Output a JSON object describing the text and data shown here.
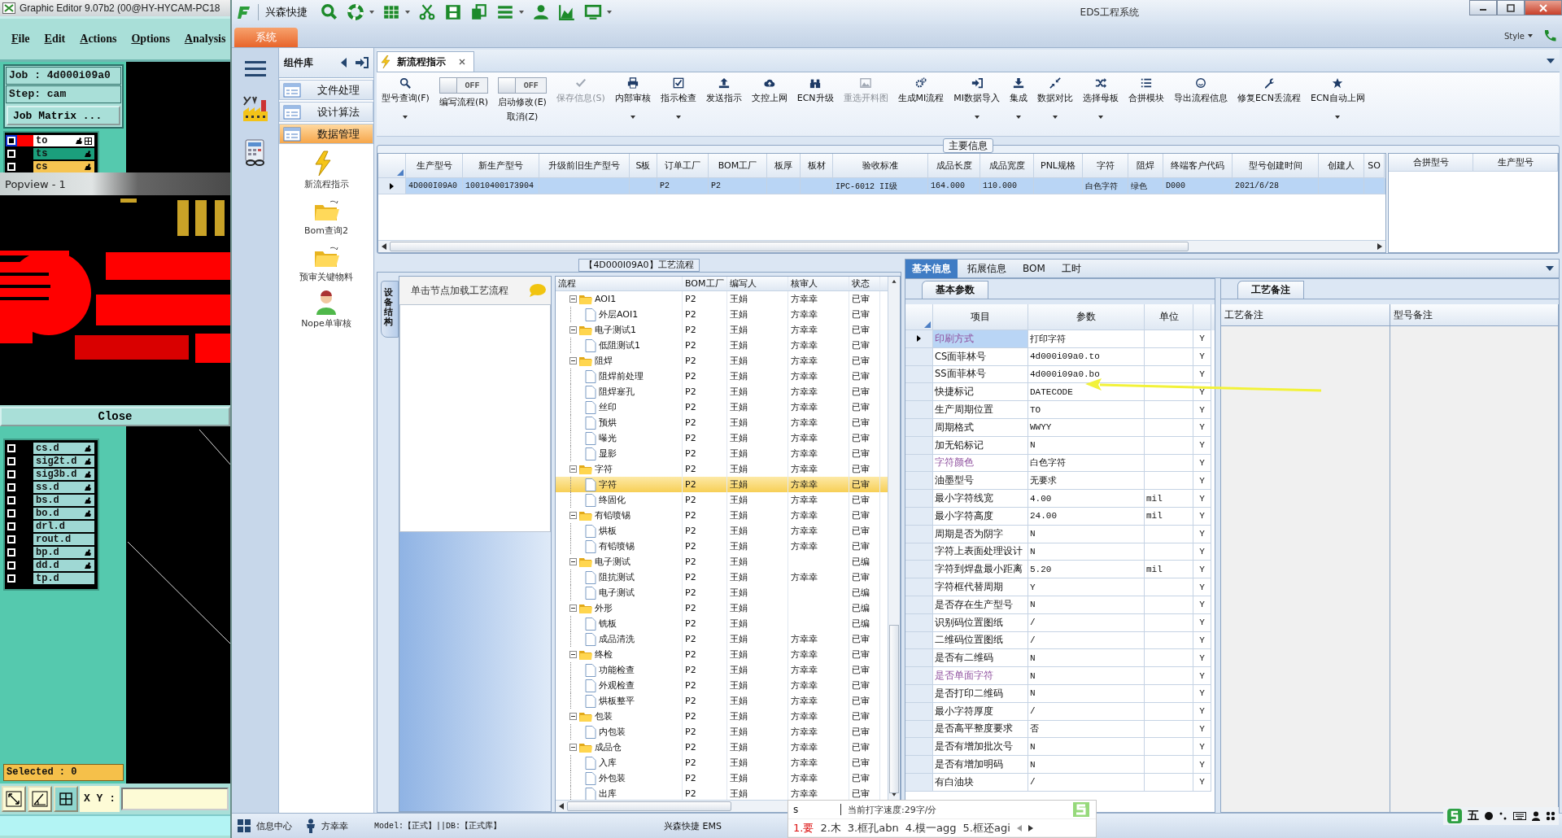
{
  "graphic_editor": {
    "title": "Graphic Editor 9.07b2 (00@HY-HYCAM-PC18",
    "menu": [
      "File",
      "Edit",
      "Actions",
      "Options",
      "Analysis"
    ],
    "job": "Job : 4d000i09a0",
    "step": "Step: cam",
    "job_matrix_button": "Job Matrix ...",
    "top_layers": [
      {
        "name": "to",
        "color": "#ffffff",
        "selected": true,
        "checked": false,
        "flagged": true
      },
      {
        "name": "ts",
        "color": "#1b9f7c",
        "selected": false,
        "checked": false,
        "flagged": true
      },
      {
        "name": "cs",
        "color": "#f6c451",
        "selected": false,
        "checked": false,
        "flagged": true
      }
    ],
    "popview": {
      "title": "Popview - 1",
      "close_button": "Close"
    },
    "layers": [
      {
        "name": "cs.d",
        "checked": false,
        "flagged": true
      },
      {
        "name": "sig2t.d",
        "checked": false,
        "flagged": true
      },
      {
        "name": "sig3b.d",
        "checked": false,
        "flagged": true
      },
      {
        "name": "ss.d",
        "checked": false,
        "flagged": true
      },
      {
        "name": "bs.d",
        "checked": false,
        "flagged": true
      },
      {
        "name": "bo.d",
        "checked": false,
        "flagged": true
      },
      {
        "name": "drl.d",
        "checked": false,
        "flagged": false
      },
      {
        "name": "rout.d",
        "checked": false,
        "flagged": false
      },
      {
        "name": "bp.d",
        "checked": false,
        "flagged": true
      },
      {
        "name": "dd.d",
        "checked": false,
        "flagged": true
      },
      {
        "name": "tp.d",
        "checked": false,
        "flagged": false
      }
    ],
    "selected_count": "Selected : 0",
    "xy_label": "X Y :"
  },
  "eds": {
    "app_name": "兴森快捷",
    "title": "EDS工程系统",
    "menu": [
      {
        "label": "系统",
        "selected": true
      }
    ],
    "style_label": "Style",
    "sidebar": {
      "title": "组件库",
      "categories": [
        {
          "label": "文件处理",
          "selected": false
        },
        {
          "label": "设计算法",
          "selected": false
        },
        {
          "label": "数据管理",
          "selected": true
        }
      ],
      "modules": [
        {
          "label": "新流程指示",
          "kind": "lightning"
        },
        {
          "label": "Bom查询2",
          "kind": "folder"
        },
        {
          "label": "预审关键物料",
          "kind": "folder"
        },
        {
          "label": "Nope单审核",
          "kind": "user"
        }
      ]
    },
    "doc_tab": {
      "label": "新流程指示"
    },
    "toolbar": [
      {
        "kind": "button",
        "label": "型号查询(F)",
        "dropdown": true,
        "disabled": false
      },
      {
        "kind": "toggle",
        "label": "编写流程(R)",
        "switch_text": "OFF",
        "on": false
      },
      {
        "kind": "toggle",
        "label": "启动修改(E)",
        "second_line": "取消(Z)",
        "switch_text": "OFF",
        "on": false
      },
      {
        "kind": "button",
        "label": "保存信息(S)",
        "dropdown": false,
        "disabled": true
      },
      {
        "kind": "button",
        "label": "内部审核",
        "dropdown": true,
        "disabled": false
      },
      {
        "kind": "button",
        "label": "指示检查",
        "dropdown": true,
        "disabled": false
      },
      {
        "kind": "button",
        "label": "发送指示",
        "dropdown": false,
        "disabled": false
      },
      {
        "kind": "button",
        "label": "文控上网",
        "dropdown": false,
        "disabled": false
      },
      {
        "kind": "button",
        "label": "ECN升级",
        "dropdown": false,
        "disabled": false
      },
      {
        "kind": "button",
        "label": "重选开料图",
        "dropdown": false,
        "disabled": true
      },
      {
        "kind": "button",
        "label": "生成MI流程",
        "dropdown": false,
        "disabled": false
      },
      {
        "kind": "button",
        "label": "MI数据导入",
        "dropdown": true,
        "disabled": false
      },
      {
        "kind": "button",
        "label": "集成",
        "dropdown": true,
        "disabled": false
      },
      {
        "kind": "button",
        "label": "数据对比",
        "dropdown": true,
        "disabled": false
      },
      {
        "kind": "button",
        "label": "选择母板",
        "dropdown": true,
        "disabled": false
      },
      {
        "kind": "button",
        "label": "合拼模块",
        "dropdown": false,
        "disabled": false
      },
      {
        "kind": "button",
        "label": "导出流程信息",
        "dropdown": false,
        "disabled": false
      },
      {
        "kind": "button",
        "label": "修复ECN丢流程",
        "dropdown": false,
        "disabled": false
      },
      {
        "kind": "button",
        "label": "ECN自动上网",
        "dropdown": true,
        "disabled": false
      }
    ],
    "main_info": {
      "title": "主要信息",
      "columns": [
        "生产型号",
        "新生产型号",
        "升级前旧生产型号",
        "S板",
        "订单工厂",
        "BOM工厂",
        "板厚",
        "板材",
        "验收标准",
        "成品长度",
        "成品宽度",
        "PNL规格",
        "字符",
        "阻焊",
        "终端客户代码",
        "型号创建时间",
        "创建人",
        "SO"
      ],
      "rows": [
        {
          "selected": true,
          "cells": [
            "4D000I09A0",
            "10010400173904",
            null,
            null,
            "P2",
            "P2",
            null,
            null,
            "IPC-6012 II级",
            "164.000",
            "110.000",
            null,
            "白色字符",
            "绿色",
            "D000",
            "2021/6/28",
            null,
            null
          ]
        }
      ],
      "side_columns": [
        "合拼型号",
        "生产型号"
      ]
    },
    "process": {
      "title": "【4D000I09A0】工艺流程",
      "side_tab": "设备结构",
      "hint": "单击节点加载工艺流程",
      "columns": [
        "流程",
        "BOM工厂",
        "编写人",
        "核审人",
        "状态"
      ],
      "tree": [
        {
          "name": "AOI1",
          "factory": "P2",
          "writer": "王娟",
          "reviewer": "方幸幸",
          "status": "已审",
          "expanded": true,
          "selected": false,
          "children": [
            {
              "name": "外层AOI1",
              "factory": "P2",
              "writer": "王娟",
              "reviewer": "方幸幸",
              "status": "已审",
              "selected": false
            }
          ]
        },
        {
          "name": "电子测试1",
          "factory": "P2",
          "writer": "王娟",
          "reviewer": "方幸幸",
          "status": "已审",
          "expanded": true,
          "selected": false,
          "children": [
            {
              "name": "低阻测试1",
              "factory": "P2",
              "writer": "王娟",
              "reviewer": "方幸幸",
              "status": "已审",
              "selected": false
            }
          ]
        },
        {
          "name": "阻焊",
          "factory": "P2",
          "writer": "王娟",
          "reviewer": "方幸幸",
          "status": "已审",
          "expanded": true,
          "selected": false,
          "children": [
            {
              "name": "阻焊前处理",
              "factory": "P2",
              "writer": "王娟",
              "reviewer": "方幸幸",
              "status": "已审",
              "selected": false
            },
            {
              "name": "阻焊塞孔",
              "factory": "P2",
              "writer": "王娟",
              "reviewer": "方幸幸",
              "status": "已审",
              "selected": false
            },
            {
              "name": "丝印",
              "factory": "P2",
              "writer": "王娟",
              "reviewer": "方幸幸",
              "status": "已审",
              "selected": false
            },
            {
              "name": "预烘",
              "factory": "P2",
              "writer": "王娟",
              "reviewer": "方幸幸",
              "status": "已审",
              "selected": false
            },
            {
              "name": "曝光",
              "factory": "P2",
              "writer": "王娟",
              "reviewer": "方幸幸",
              "status": "已审",
              "selected": false
            },
            {
              "name": "显影",
              "factory": "P2",
              "writer": "王娟",
              "reviewer": "方幸幸",
              "status": "已审",
              "selected": false
            }
          ]
        },
        {
          "name": "字符",
          "factory": "P2",
          "writer": "王娟",
          "reviewer": "方幸幸",
          "status": "已审",
          "expanded": true,
          "selected": false,
          "children": [
            {
              "name": "字符",
              "factory": "P2",
              "writer": "王娟",
              "reviewer": "方幸幸",
              "status": "已审",
              "selected": true
            },
            {
              "name": "终固化",
              "factory": "P2",
              "writer": "王娟",
              "reviewer": "方幸幸",
              "status": "已审",
              "selected": false
            }
          ]
        },
        {
          "name": "有铅喷锡",
          "factory": "P2",
          "writer": "王娟",
          "reviewer": "方幸幸",
          "status": "已审",
          "expanded": true,
          "selected": false,
          "children": [
            {
              "name": "烘板",
              "factory": "P2",
              "writer": "王娟",
              "reviewer": "方幸幸",
              "status": "已审",
              "selected": false
            },
            {
              "name": "有铅喷锡",
              "factory": "P2",
              "writer": "王娟",
              "reviewer": "方幸幸",
              "status": "已审",
              "selected": false
            }
          ]
        },
        {
          "name": "电子测试",
          "factory": "P2",
          "writer": "王娟",
          "status": "已编",
          "expanded": true,
          "selected": false,
          "children": [
            {
              "name": "阻抗测试",
              "factory": "P2",
              "writer": "王娟",
              "reviewer": "方幸幸",
              "status": "已审",
              "selected": false
            },
            {
              "name": "电子测试",
              "factory": "P2",
              "writer": "王娟",
              "status": "已编",
              "selected": false
            }
          ]
        },
        {
          "name": "外形",
          "factory": "P2",
          "writer": "王娟",
          "status": "已编",
          "expanded": true,
          "selected": false,
          "children": [
            {
              "name": "铣板",
              "factory": "P2",
              "writer": "王娟",
              "status": "已编",
              "selected": false
            },
            {
              "name": "成品清洗",
              "factory": "P2",
              "writer": "王娟",
              "reviewer": "方幸幸",
              "status": "已审",
              "selected": false
            }
          ]
        },
        {
          "name": "终检",
          "factory": "P2",
          "writer": "王娟",
          "reviewer": "方幸幸",
          "status": "已审",
          "expanded": true,
          "selected": false,
          "children": [
            {
              "name": "功能检查",
              "factory": "P2",
              "writer": "王娟",
              "reviewer": "方幸幸",
              "status": "已审",
              "selected": false
            },
            {
              "name": "外观检查",
              "factory": "P2",
              "writer": "王娟",
              "reviewer": "方幸幸",
              "status": "已审",
              "selected": false
            },
            {
              "name": "烘板整平",
              "factory": "P2",
              "writer": "王娟",
              "reviewer": "方幸幸",
              "status": "已审",
              "selected": false
            }
          ]
        },
        {
          "name": "包装",
          "factory": "P2",
          "writer": "王娟",
          "reviewer": "方幸幸",
          "status": "已审",
          "expanded": true,
          "selected": false,
          "children": [
            {
              "name": "内包装",
              "factory": "P2",
              "writer": "王娟",
              "reviewer": "方幸幸",
              "status": "已审",
              "selected": false
            }
          ]
        },
        {
          "name": "成品仓",
          "factory": "P2",
          "writer": "王娟",
          "reviewer": "方幸幸",
          "status": "已审",
          "expanded": true,
          "selected": false,
          "children": [
            {
              "name": "入库",
              "factory": "P2",
              "writer": "王娟",
              "reviewer": "方幸幸",
              "status": "已审",
              "selected": false
            },
            {
              "name": "外包装",
              "factory": "P2",
              "writer": "王娟",
              "reviewer": "方幸幸",
              "status": "已审",
              "selected": false
            },
            {
              "name": "出库",
              "factory": "P2",
              "writer": "王娟",
              "reviewer": "方幸幸",
              "status": "已审",
              "selected": false
            }
          ]
        }
      ]
    },
    "details": {
      "tabs": [
        {
          "label": "基本信息",
          "selected": true
        },
        {
          "label": "拓展信息",
          "selected": false
        },
        {
          "label": "BOM",
          "selected": false
        },
        {
          "label": "工时",
          "selected": false
        }
      ],
      "params_tab": "基本参数",
      "columns": [
        "项目",
        "参数",
        "单位"
      ],
      "rows": [
        {
          "item": "印刷方式",
          "value": "打印字符",
          "flag": "Y",
          "highlighted": true,
          "selected": true
        },
        {
          "item": "CS面菲林号",
          "value": "4d000i09a0.to",
          "flag": "Y",
          "highlighted": false,
          "selected": false
        },
        {
          "item": "SS面菲林号",
          "value": "4d000i09a0.bo",
          "flag": "Y",
          "highlighted": false,
          "selected": false
        },
        {
          "item": "快捷标记",
          "value": "DATECODE",
          "flag": "Y",
          "highlighted": false,
          "selected": false
        },
        {
          "item": "生产周期位置",
          "value": "TO",
          "flag": "Y",
          "highlighted": false,
          "selected": false
        },
        {
          "item": "周期格式",
          "value": "WWYY",
          "flag": "Y",
          "highlighted": false,
          "selected": false
        },
        {
          "item": "加无铅标记",
          "value": "N",
          "flag": "Y",
          "highlighted": false,
          "selected": false
        },
        {
          "item": "字符颜色",
          "value": "白色字符",
          "flag": "Y",
          "highlighted": true,
          "selected": false
        },
        {
          "item": "油墨型号",
          "value": "无要求",
          "flag": "Y",
          "highlighted": false,
          "selected": false
        },
        {
          "item": "最小字符线宽",
          "value": "4.00",
          "unit": "mil",
          "flag": "Y",
          "highlighted": false,
          "selected": false
        },
        {
          "item": "最小字符高度",
          "value": "24.00",
          "unit": "mil",
          "flag": "Y",
          "highlighted": false,
          "selected": false
        },
        {
          "item": "周期是否为阴字",
          "value": "N",
          "flag": "Y",
          "highlighted": false,
          "selected": false
        },
        {
          "item": "字符上表面处理设计",
          "value": "N",
          "flag": "Y",
          "highlighted": false,
          "selected": false
        },
        {
          "item": "字符到焊盘最小距离",
          "value": "5.20",
          "unit": "mil",
          "flag": "Y",
          "highlighted": false,
          "selected": false
        },
        {
          "item": "字符框代替周期",
          "value": "Y",
          "flag": "Y",
          "highlighted": false,
          "selected": false
        },
        {
          "item": "是否存在生产型号",
          "value": "N",
          "flag": "Y",
          "highlighted": false,
          "selected": false
        },
        {
          "item": "识别码位置图纸",
          "value": "/",
          "flag": "Y",
          "highlighted": false,
          "selected": false
        },
        {
          "item": "二维码位置图纸",
          "value": "/",
          "flag": "Y",
          "highlighted": false,
          "selected": false
        },
        {
          "item": "是否有二维码",
          "value": "N",
          "flag": "Y",
          "highlighted": false,
          "selected": false
        },
        {
          "item": "是否单面字符",
          "value": "N",
          "flag": "Y",
          "highlighted": true,
          "selected": false
        },
        {
          "item": "是否打印二维码",
          "value": "N",
          "flag": "Y",
          "highlighted": false,
          "selected": false
        },
        {
          "item": "最小字符厚度",
          "value": "/",
          "flag": "Y",
          "highlighted": false,
          "selected": false
        },
        {
          "item": "是否高平整度要求",
          "value": "否",
          "flag": "Y",
          "highlighted": false,
          "selected": false
        },
        {
          "item": "是否有增加批次号",
          "value": "N",
          "flag": "Y",
          "highlighted": false,
          "selected": false
        },
        {
          "item": "是否有增加明码",
          "value": "N",
          "flag": "Y",
          "highlighted": false,
          "selected": false
        },
        {
          "item": "有白油块",
          "value": "/",
          "flag": "Y",
          "highlighted": false,
          "selected": false
        }
      ],
      "notes_tab": "工艺备注",
      "notes_columns": [
        "工艺备注",
        "型号备注"
      ]
    },
    "status_bar": {
      "info_center": "信息中心",
      "user": "方幸幸",
      "model": "Model:【正式】||DB:【正式库】",
      "app": "兴森快捷 EMS"
    }
  },
  "ime": {
    "input": "s",
    "speed": "当前打字速度:29字/分",
    "candidates": [
      "1.要",
      "2.木",
      "3.框孔abn",
      "4.模一agg",
      "5.框还agi"
    ],
    "mode": "五"
  }
}
